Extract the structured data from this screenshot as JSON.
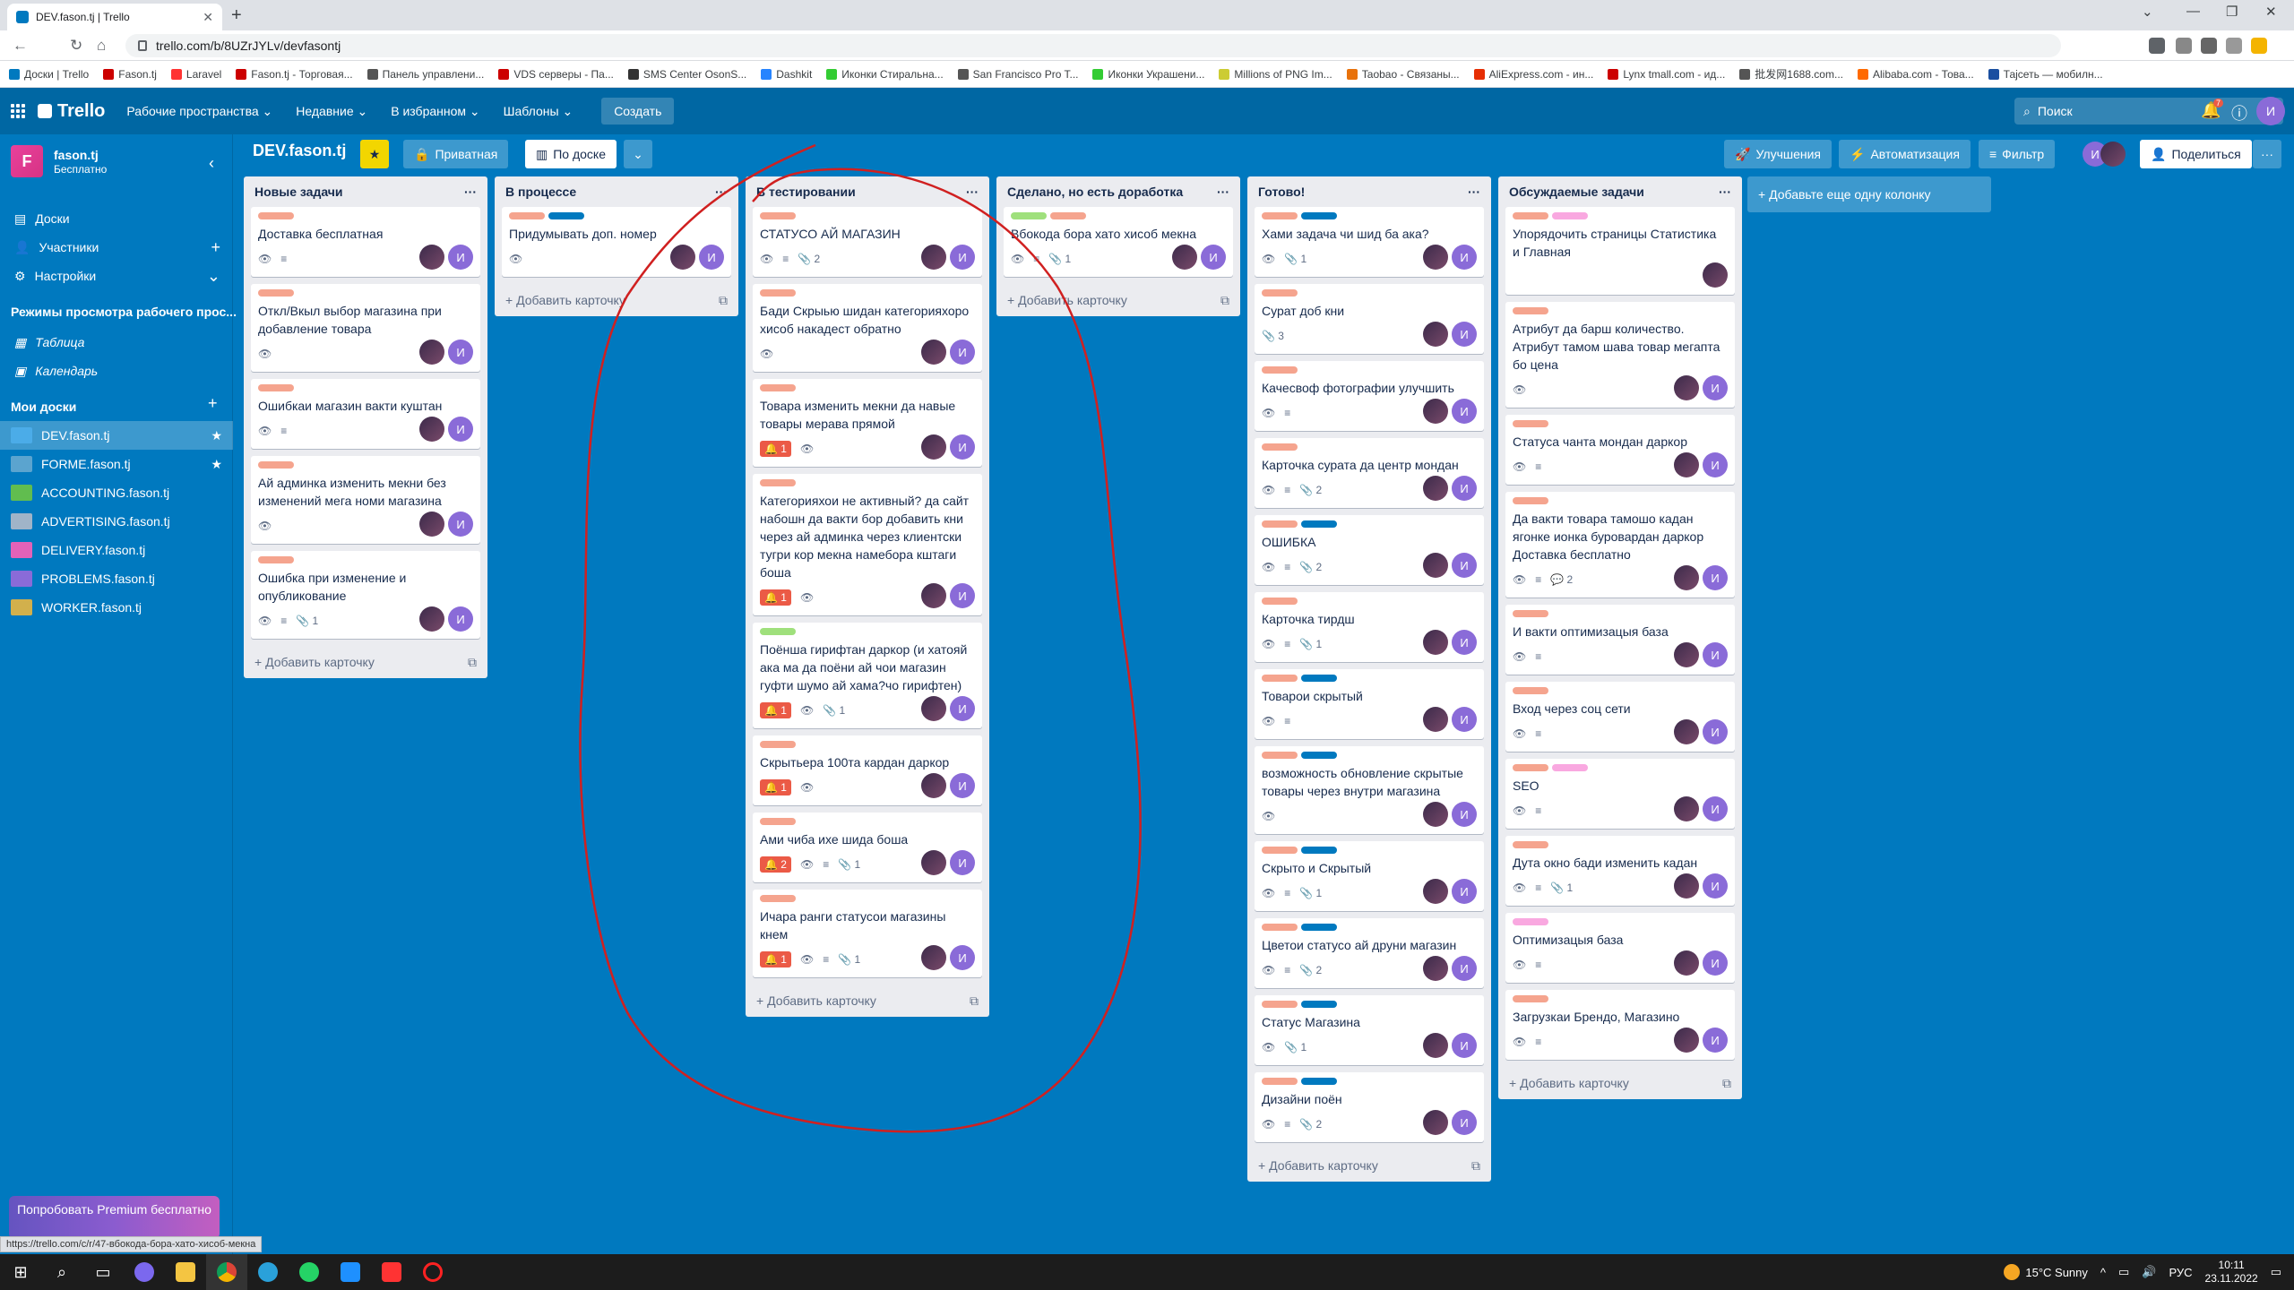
{
  "browser": {
    "tab_title": "DEV.fason.tj | Trello",
    "url": "trello.com/b/8UZrJYLv/devfasontj"
  },
  "bookmarks": [
    "Доски | Trello",
    "Fason.tj",
    "Laravel",
    "Fason.tj - Торговая...",
    "Панель управлени...",
    "VDS серверы - Па...",
    "SMS Center OsonS...",
    "Dashkit",
    "Иконки Стиральна...",
    "San Francisco Pro T...",
    "Иконки Украшени...",
    "Millions of PNG Im...",
    "Taobao - Связаны...",
    "AliExpress.com - ин...",
    "Lynx tmall.com - ид...",
    "批发网1688.com...",
    "Alibaba.com - Това...",
    "Тајсеть — мобилн..."
  ],
  "bookmark_colors": [
    "#0079bf",
    "#c00",
    "#f33",
    "#c00",
    "#555",
    "#c00",
    "#333",
    "#2684ff",
    "#3c3",
    "#555",
    "#3c3",
    "#cc3",
    "#e8720c",
    "#e62e04",
    "#c00",
    "#555",
    "#ff6a00",
    "#1a4fa0"
  ],
  "header": {
    "logo": "Trello",
    "menus": [
      "Рабочие пространства",
      "Недавние",
      "В избранном",
      "Шаблоны"
    ],
    "create": "Создать",
    "search": "Поиск",
    "notif_count": "7",
    "avatar": "И"
  },
  "sidebar": {
    "ws_letter": "F",
    "ws_name": "fason.tj",
    "ws_plan": "Бесплатно",
    "items": [
      "Доски",
      "Участники",
      "Настройки"
    ],
    "views_heading": "Режимы просмотра рабочего прос...",
    "views": [
      "Таблица",
      "Календарь"
    ],
    "boards_heading": "Мои доски",
    "boards": [
      {
        "name": "DEV.fason.tj",
        "color": "#4bace8",
        "star": true,
        "active": true
      },
      {
        "name": "FORME.fason.tj",
        "color": "#5ba4cf",
        "star": true
      },
      {
        "name": "ACCOUNTING.fason.tj",
        "color": "#61bd4f"
      },
      {
        "name": "ADVERTISING.fason.tj",
        "color": "#a0b4c8"
      },
      {
        "name": "DELIVERY.fason.tj",
        "color": "#e362b8"
      },
      {
        "name": "PROBLEMS.fason.tj",
        "color": "#8a6bd8"
      },
      {
        "name": "WORKER.fason.tj",
        "color": "#d2b04c"
      }
    ],
    "premium": "Попробовать Premium бесплатно"
  },
  "board": {
    "title": "DEV.fason.tj",
    "visibility": "Приватная",
    "view": "По доске",
    "improve": "Улучшения",
    "automation": "Автоматизация",
    "filter": "Фильтр",
    "share": "Поделиться",
    "add_list": "+ Добавьте еще одну колонку"
  },
  "add_card": "+ Добавить карточку",
  "lists": [
    {
      "title": "Новые задачи",
      "cards": [
        {
          "labels": [
            "#f5a48e"
          ],
          "title": "Доставка бесплатная",
          "badges": [
            "eye",
            "desc"
          ]
        },
        {
          "labels": [
            "#f5a48e"
          ],
          "title": "Откл/Вкыл выбор магазина при добавление товара",
          "badges": [
            "eye"
          ]
        },
        {
          "labels": [
            "#f5a48e"
          ],
          "title": "Ошибкаи магазин вакти куштан",
          "badges": [
            "eye",
            "desc"
          ]
        },
        {
          "labels": [
            "#f5a48e"
          ],
          "title": "Ай админка изменить мекни без изменений мега номи магазина",
          "badges": [
            "eye"
          ]
        },
        {
          "labels": [
            "#f5a48e"
          ],
          "title": "Ошибка при изменение и опубликование",
          "badges": [
            "eye",
            "desc",
            "att:1"
          ]
        }
      ]
    },
    {
      "title": "В процессе",
      "cards": [
        {
          "labels": [
            "#f5a48e",
            "#0079bf"
          ],
          "title": "Придумывать доп. номер",
          "badges": [
            "eye"
          ]
        }
      ]
    },
    {
      "title": "В тестировании",
      "cards": [
        {
          "labels": [
            "#f5a48e"
          ],
          "title": "СТАТУСО АЙ МАГАЗИН",
          "badges": [
            "eye",
            "desc",
            "att:2"
          ]
        },
        {
          "labels": [
            "#f5a48e"
          ],
          "title": "Бади Скрыью шидан категорияхоро хисоб накадест обратно",
          "badges": [
            "eye"
          ]
        },
        {
          "labels": [
            "#f5a48e"
          ],
          "title": "Товара изменить мекни да навые товары мерава прямой",
          "badges": [
            "due:1",
            "eye"
          ]
        },
        {
          "labels": [
            "#f5a48e"
          ],
          "title": "Категорияхои не активный? да сайт набошн да вакти бор добавить кни через ай админка через клиентски тугри кор мекна намебора кштаги боша",
          "badges": [
            "due:1",
            "eye"
          ]
        },
        {
          "labels": [
            "#9fe07c"
          ],
          "title": "Поёнша гирифтан даркор (и хатояй ака ма да поёни ай чои магазин гуфти шумо ай хама?чо гирифтен)",
          "badges": [
            "due:1",
            "eye",
            "att:1"
          ]
        },
        {
          "labels": [
            "#f5a48e"
          ],
          "title": "Скрытьера 100та кардан даркор",
          "badges": [
            "due:1",
            "eye"
          ]
        },
        {
          "labels": [
            "#f5a48e"
          ],
          "title": "Ами чиба ихе шида боша",
          "badges": [
            "due:2",
            "eye",
            "desc",
            "att:1"
          ]
        },
        {
          "labels": [
            "#f5a48e"
          ],
          "title": "Ичара ранги статусои магазины кнем",
          "badges": [
            "due:1",
            "eye",
            "desc",
            "att:1"
          ]
        }
      ]
    },
    {
      "title": "Сделано, но есть доработка",
      "cards": [
        {
          "labels": [
            "#9fe07c",
            "#f5a48e"
          ],
          "title": "Вбокода бора хато хисоб мекна",
          "badges": [
            "eye",
            "desc",
            "att:1"
          ]
        }
      ]
    },
    {
      "title": "Готово!",
      "cards": [
        {
          "labels": [
            "#f5a48e",
            "#0079bf"
          ],
          "title": "Хами задача чи шид ба ака?",
          "badges": [
            "eye",
            "att:1"
          ]
        },
        {
          "labels": [
            "#f5a48e"
          ],
          "title": "Сурат доб кни",
          "badges": [
            "att:3"
          ]
        },
        {
          "labels": [
            "#f5a48e"
          ],
          "title": "Качесвоф фотографии улучшить",
          "badges": [
            "eye",
            "desc"
          ]
        },
        {
          "labels": [
            "#f5a48e"
          ],
          "title": "Карточка сурата да центр мондан",
          "badges": [
            "eye",
            "desc",
            "att:2"
          ]
        },
        {
          "labels": [
            "#f5a48e",
            "#0079bf"
          ],
          "title": "ОШИБКА",
          "badges": [
            "eye",
            "desc",
            "att:2"
          ]
        },
        {
          "labels": [
            "#f5a48e"
          ],
          "title": "Карточка тирдш",
          "badges": [
            "eye",
            "desc",
            "att:1"
          ]
        },
        {
          "labels": [
            "#f5a48e",
            "#0079bf"
          ],
          "title": "Товарои скрытый",
          "badges": [
            "eye",
            "desc"
          ]
        },
        {
          "labels": [
            "#f5a48e",
            "#0079bf"
          ],
          "title": "возможность обновление скрытые товары через внутри магазина",
          "badges": [
            "eye"
          ]
        },
        {
          "labels": [
            "#f5a48e",
            "#0079bf"
          ],
          "title": "Скрыто и Скрытый",
          "badges": [
            "eye",
            "desc",
            "att:1"
          ]
        },
        {
          "labels": [
            "#f5a48e",
            "#0079bf"
          ],
          "title": "Цветои статусо ай друни магазин",
          "badges": [
            "eye",
            "desc",
            "att:2"
          ]
        },
        {
          "labels": [
            "#f5a48e",
            "#0079bf"
          ],
          "title": "Статус Магазина",
          "badges": [
            "eye",
            "att:1"
          ]
        },
        {
          "labels": [
            "#f5a48e",
            "#0079bf"
          ],
          "title": "Дизайни поён",
          "badges": [
            "eye",
            "desc",
            "att:2"
          ]
        }
      ]
    },
    {
      "title": "Обсуждаемые задачи",
      "cards": [
        {
          "labels": [
            "#f5a48e",
            "#f9a8e0"
          ],
          "title": "Упорядочить страницы Статистика и Главная",
          "badges": []
        },
        {
          "labels": [
            "#f5a48e"
          ],
          "title": "Атрибут да барш количество. Атрибут тамом шава товар мегапта бо цена",
          "badges": [
            "eye"
          ]
        },
        {
          "labels": [
            "#f5a48e"
          ],
          "title": "Статуса чанта мондан даркор",
          "badges": [
            "eye",
            "desc"
          ]
        },
        {
          "labels": [
            "#f5a48e"
          ],
          "title": "Да вакти товара тамошо кадан ягонке ионка буровардан даркор Доставка бесплатно",
          "badges": [
            "eye",
            "desc",
            "comm:2"
          ]
        },
        {
          "labels": [
            "#f5a48e"
          ],
          "title": "И вакти оптимизацыя база",
          "badges": [
            "eye",
            "desc"
          ]
        },
        {
          "labels": [
            "#f5a48e"
          ],
          "title": "Вход через соц сети",
          "badges": [
            "eye",
            "desc"
          ]
        },
        {
          "labels": [
            "#f5a48e",
            "#f9a8e0"
          ],
          "title": "SEO",
          "badges": [
            "eye",
            "desc"
          ]
        },
        {
          "labels": [
            "#f5a48e"
          ],
          "title": "Дута окно бади изменить кадан",
          "badges": [
            "eye",
            "desc",
            "att:1"
          ]
        },
        {
          "labels": [
            "#f9a8e0"
          ],
          "title": "Оптимизацыя база",
          "badges": [
            "eye",
            "desc"
          ]
        },
        {
          "labels": [
            "#f5a48e"
          ],
          "title": "Загрузкаи Брендо, Магазино",
          "badges": [
            "eye",
            "desc"
          ]
        }
      ]
    }
  ],
  "status_link": "https://trello.com/c/r/47-вбокода-бора-хато-хисоб-мекна",
  "taskbar": {
    "weather": "15°C Sunny",
    "lang": "РУС",
    "time": "10:11",
    "date": "23.11.2022"
  }
}
